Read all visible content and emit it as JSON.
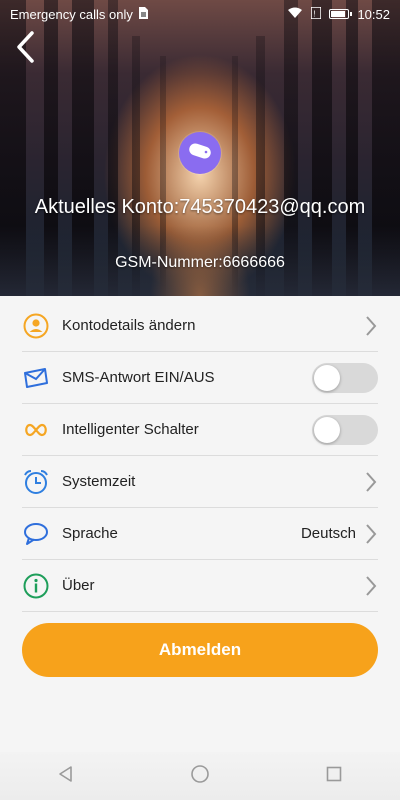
{
  "status_bar": {
    "carrier_text": "Emergency calls only",
    "time": "10:52",
    "icons": [
      "sim-card-icon",
      "wifi-icon",
      "signal-icon",
      "battery-icon"
    ]
  },
  "header": {
    "back_icon": "back-arrow-icon",
    "avatar_icon": "device-icon",
    "account_text": "Aktuelles Konto:745370423@qq.com",
    "gsm_text": "GSM-Nummer:6666666"
  },
  "menu": [
    {
      "icon": "person-icon",
      "label": "Kontodetails ändern",
      "control": "chevron",
      "color": "#f5a623"
    },
    {
      "icon": "envelope-icon",
      "label": "SMS-Antwort EIN/AUS",
      "control": "toggle",
      "on": false,
      "color": "#2f6fdc"
    },
    {
      "icon": "infinity-icon",
      "label": "Intelligenter Schalter",
      "control": "toggle",
      "on": false,
      "color": "#f5a623"
    },
    {
      "icon": "alarm-clock-icon",
      "label": "Systemzeit",
      "control": "chevron",
      "color": "#2f7fe0"
    },
    {
      "icon": "chat-bubble-icon",
      "label": "Sprache",
      "value": "Deutsch",
      "control": "chevron",
      "color": "#2f6fdc"
    },
    {
      "icon": "info-icon",
      "label": "Über",
      "control": "chevron",
      "color": "#1e9e5a"
    }
  ],
  "logout_label": "Abmelden",
  "navbar": [
    "back-triangle-icon",
    "home-circle-icon",
    "recents-square-icon"
  ],
  "colors": {
    "accent": "#f7a21b",
    "toggle_off": "#d9d9d9"
  }
}
